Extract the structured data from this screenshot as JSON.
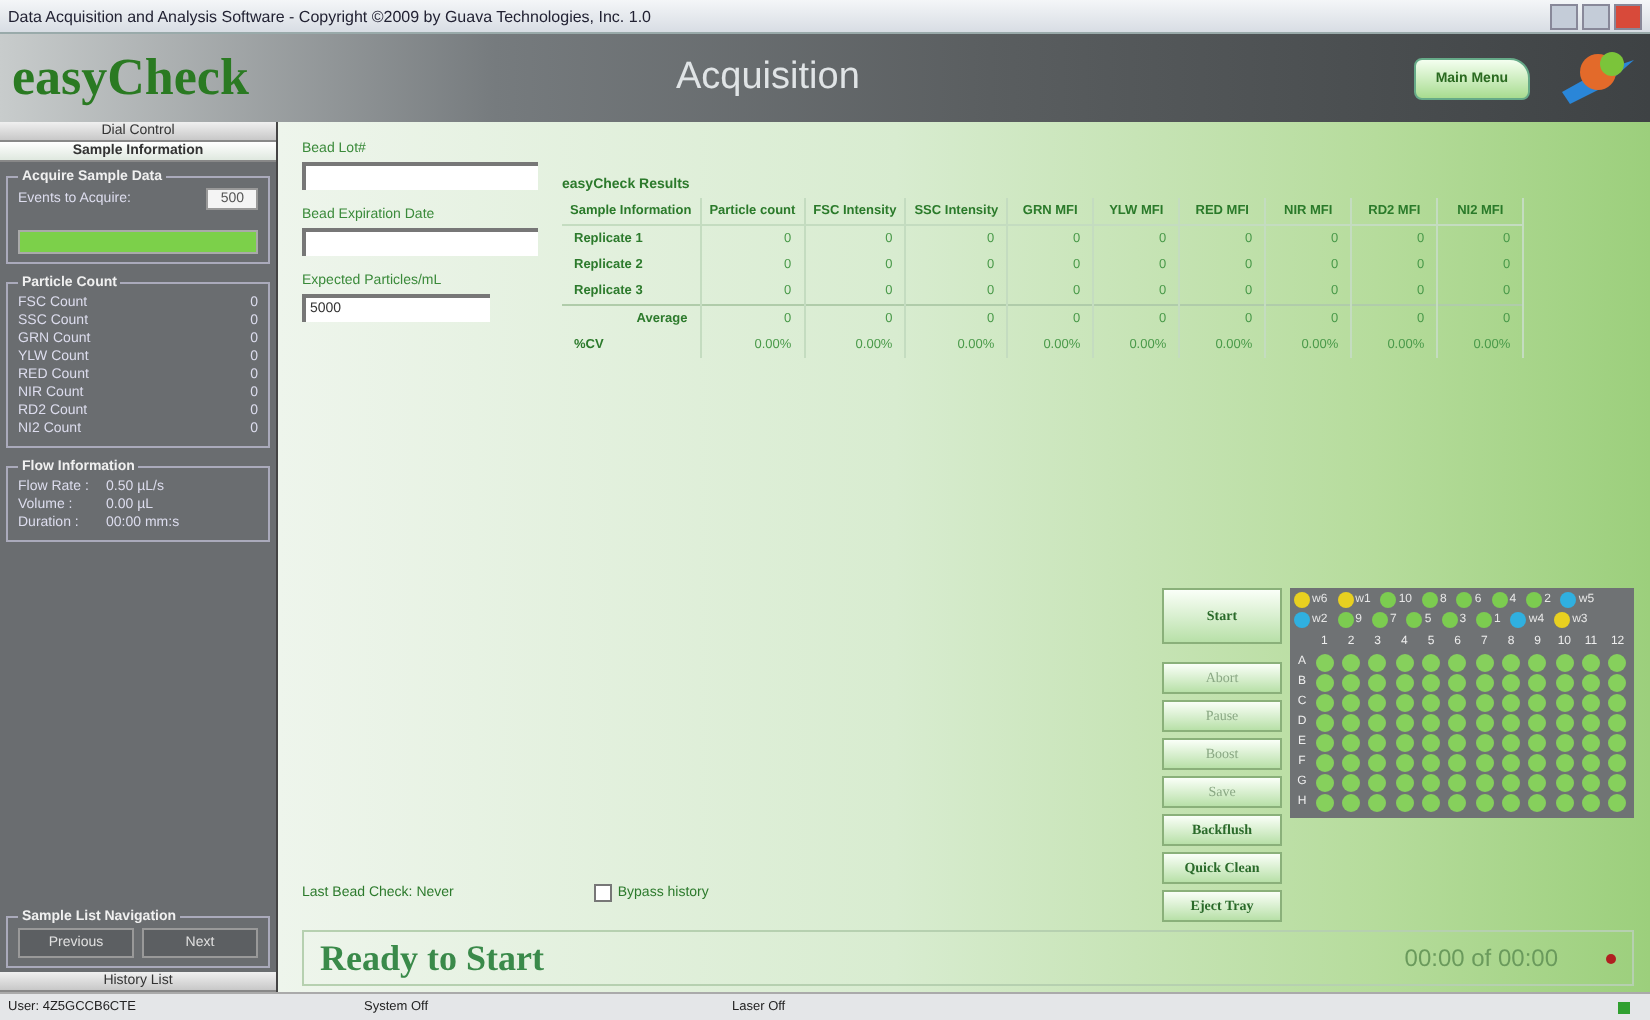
{
  "window": {
    "title": "Data Acquisition and Analysis Software - Copyright ©2009 by Guava Technologies, Inc. 1.0"
  },
  "header": {
    "logo": "easyCheck",
    "screen_title": "Acquisition",
    "main_menu_button": "Main Menu"
  },
  "sidebar": {
    "tabs": [
      {
        "label": "Dial Control",
        "selected": false
      },
      {
        "label": "Sample Information",
        "selected": true
      }
    ],
    "acquire": {
      "title": "Acquire Sample Data",
      "events_label": "Events to Acquire:",
      "events_value": "500",
      "level": 1
    },
    "particle_count": {
      "title": "Particle Count",
      "rows": [
        {
          "label": "FSC Count",
          "value": "0"
        },
        {
          "label": "SSC Count",
          "value": "0"
        },
        {
          "label": "GRN Count",
          "value": "0"
        },
        {
          "label": "YLW Count",
          "value": "0"
        },
        {
          "label": "RED Count",
          "value": "0"
        },
        {
          "label": "NIR Count",
          "value": "0"
        },
        {
          "label": "RD2 Count",
          "value": "0"
        },
        {
          "label": "NI2 Count",
          "value": "0"
        }
      ]
    },
    "flow": {
      "title": "Flow Information",
      "rows": [
        {
          "label": "Flow Rate :",
          "value": "0.50 µL/s"
        },
        {
          "label": "Volume :",
          "value": "0.00 µL"
        },
        {
          "label": "Duration :",
          "value": "00:00 mm:s"
        }
      ]
    },
    "navigation": {
      "title": "Sample List Navigation",
      "buttons": [
        {
          "label": "Previous",
          "disabled": true
        },
        {
          "label": "Next",
          "disabled": true
        }
      ]
    },
    "bottom_tab": "History List"
  },
  "fields": [
    {
      "label": "Bead Lot#"
    },
    {
      "label": "Bead Expiration Date"
    },
    {
      "label": "Expected Particles/mL",
      "value": "5000"
    }
  ],
  "results": {
    "title": "easyCheck Results",
    "columns": [
      "Sample Information",
      "Particle count",
      "FSC Intensity",
      "SSC Intensity",
      "GRN MFI",
      "YLW MFI",
      "RED MFI",
      "NIR MFI",
      "RD2 MFI",
      "NI2 MFI"
    ],
    "rows": [
      [
        "Replicate 1",
        "0",
        "0",
        "0",
        "0",
        "0",
        "0",
        "0",
        "0",
        "0"
      ],
      [
        "Replicate 2",
        "0",
        "0",
        "0",
        "0",
        "0",
        "0",
        "0",
        "0",
        "0"
      ],
      [
        "Replicate 3",
        "0",
        "0",
        "0",
        "0",
        "0",
        "0",
        "0",
        "0",
        "0"
      ],
      [
        "Average",
        "0",
        "0",
        "0",
        "0",
        "0",
        "0",
        "0",
        "0",
        "0"
      ],
      [
        "%CV",
        "0.00%",
        "0.00%",
        "0.00%",
        "0.00%",
        "0.00%",
        "0.00%",
        "0.00%",
        "0.00%",
        "0.00%"
      ]
    ]
  },
  "last_bead_check": "Last Bead Check: Never",
  "bypass": {
    "label": "Bypass history",
    "checked": false
  },
  "controls": [
    {
      "label": "Start",
      "disabled": false
    },
    {
      "label": "Abort",
      "disabled": true
    },
    {
      "label": "Pause",
      "disabled": true
    },
    {
      "label": "Boost",
      "disabled": true
    },
    {
      "label": "Save",
      "disabled": true
    },
    {
      "label": "Backflush",
      "disabled": false
    },
    {
      "label": "Quick Clean",
      "disabled": false
    },
    {
      "label": "Eject Tray",
      "disabled": false
    }
  ],
  "legend": [
    {
      "label": "w6",
      "color": "#e8d020"
    },
    {
      "label": "w1",
      "color": "#e8d020"
    },
    {
      "label": "10",
      "color": "#7ccc50"
    },
    {
      "label": "8",
      "color": "#7ccc50"
    },
    {
      "label": "6",
      "color": "#7ccc50"
    },
    {
      "label": "4",
      "color": "#7ccc50"
    },
    {
      "label": "2",
      "color": "#7ccc50"
    },
    {
      "label": "w5",
      "color": "#30b0e0"
    },
    {
      "label": "w2",
      "color": "#30b0e0"
    },
    {
      "label": "9",
      "color": "#7ccc50"
    },
    {
      "label": "7",
      "color": "#7ccc50"
    },
    {
      "label": "5",
      "color": "#7ccc50"
    },
    {
      "label": "3",
      "color": "#7ccc50"
    },
    {
      "label": "1",
      "color": "#7ccc50"
    },
    {
      "label": "w4",
      "color": "#30b0e0"
    },
    {
      "label": "w3",
      "color": "#e8d020"
    }
  ],
  "plate": {
    "columns": [
      "1",
      "2",
      "3",
      "4",
      "5",
      "6",
      "7",
      "8",
      "9",
      "10",
      "11",
      "12"
    ],
    "rows": [
      "A",
      "B",
      "C",
      "D",
      "E",
      "F",
      "G",
      "H"
    ]
  },
  "status": {
    "message": "Ready to Start",
    "time": "00:00 of 00:00"
  },
  "status_bar": [
    "User: 4Z5GCCB6CTE",
    "System Off",
    "Laser Off"
  ]
}
